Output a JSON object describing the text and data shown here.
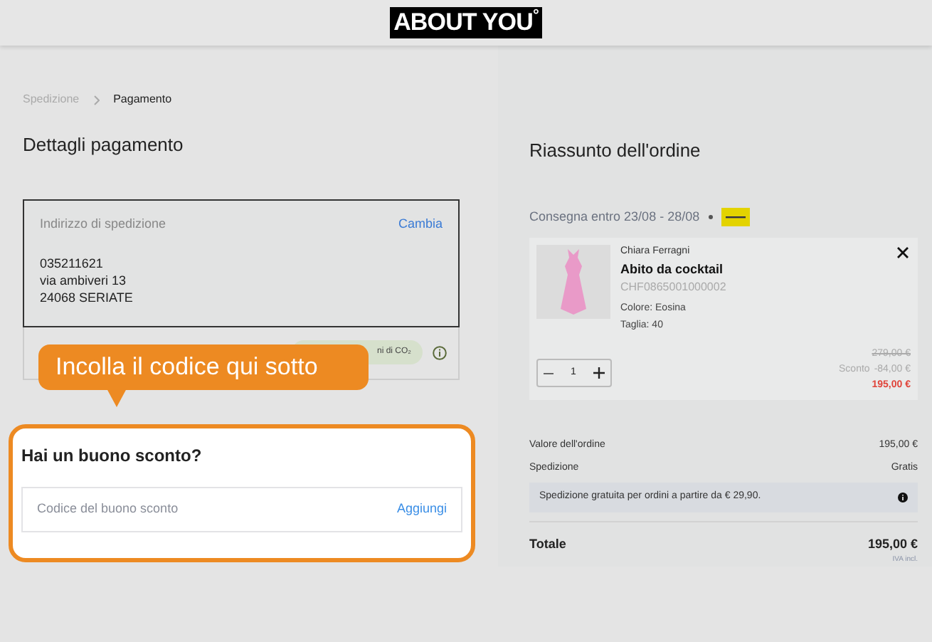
{
  "header": {
    "logo": "ABOUT YOU",
    "logo_mark": "°"
  },
  "breadcrumb": [
    {
      "label": "Spedizione",
      "selected": false
    },
    {
      "label": "Pagamento",
      "selected": true
    }
  ],
  "payment": {
    "title": "Dettagli pagamento",
    "address": {
      "label": "Indirizzo di spedizione",
      "action": "Cambia",
      "lines": [
        "035211621",
        "via ambiveri 13",
        "24068 SERIATE"
      ]
    },
    "co2_badge": "ni di CO₂"
  },
  "tooltip": "Incolla il codice qui sotto",
  "coupon": {
    "title": "Hai un buono sconto?",
    "placeholder": "Codice del buono sconto",
    "action": "Aggiungi"
  },
  "summary": {
    "title": "Riassunto dell'ordine",
    "delivery": "Consegna entro 23/08 - 28/08",
    "item": {
      "brand": "Chiara Ferragni",
      "name": "Abito da cocktail",
      "sku": "CHF0865001000002",
      "attributes": [
        "Colore: Eosina",
        "Taglia: 40"
      ],
      "quantity": "1",
      "old_price": "279,00 €",
      "discount_label": "Sconto",
      "discount": "-84,00 €",
      "price": "195,00 €"
    },
    "rows": [
      {
        "label": "Valore dell'ordine",
        "value": "195,00 €"
      },
      {
        "label": "Spedizione",
        "value": "Gratis"
      }
    ],
    "notice": "Spedizione gratuita per ordini a partire da € 29,90.",
    "total_label": "Totale",
    "total": "195,00 €",
    "tax_note": "IVA incl."
  }
}
